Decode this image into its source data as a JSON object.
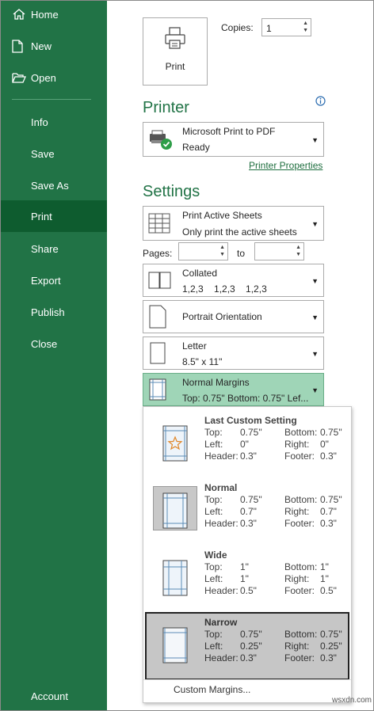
{
  "sidebar": {
    "items": [
      {
        "label": "Home",
        "icon": "home-icon"
      },
      {
        "label": "New",
        "icon": "new-document-icon"
      },
      {
        "label": "Open",
        "icon": "open-folder-icon"
      },
      {
        "label": "Info"
      },
      {
        "label": "Save"
      },
      {
        "label": "Save As"
      },
      {
        "label": "Print",
        "active": true
      },
      {
        "label": "Share"
      },
      {
        "label": "Export"
      },
      {
        "label": "Publish"
      },
      {
        "label": "Close"
      },
      {
        "label": "Account"
      }
    ],
    "bg_color": "#217346",
    "active_color": "#0e5c2f"
  },
  "print": {
    "button_label": "Print",
    "copies_label": "Copies:",
    "copies_value": "1"
  },
  "printer": {
    "title": "Printer",
    "name": "Microsoft Print to PDF",
    "status": "Ready",
    "properties_link": "Printer Properties"
  },
  "settings": {
    "title": "Settings",
    "scope": {
      "line1": "Print Active Sheets",
      "line2": "Only print the active sheets"
    },
    "pages_label": "Pages:",
    "pages_to_label": "to",
    "collation": {
      "line1": "Collated",
      "line2": "1,2,3    1,2,3    1,2,3"
    },
    "orientation": {
      "line1": "Portrait Orientation"
    },
    "paper": {
      "line1": "Letter",
      "line2": "8.5\" x 11\""
    },
    "margins": {
      "line1": "Normal Margins",
      "line2": "Top: 0.75\" Bottom: 0.75\" Lef..."
    }
  },
  "margin_options": [
    {
      "name": "Last Custom Setting",
      "top": "0.75\"",
      "bottom": "0.75\"",
      "left": "0\"",
      "right": "0\"",
      "header": "0.3\"",
      "footer": "0.3\""
    },
    {
      "name": "Normal",
      "top": "0.75\"",
      "bottom": "0.75\"",
      "left": "0.7\"",
      "right": "0.7\"",
      "header": "0.3\"",
      "footer": "0.3\""
    },
    {
      "name": "Wide",
      "top": "1\"",
      "bottom": "1\"",
      "left": "1\"",
      "right": "1\"",
      "header": "0.5\"",
      "footer": "0.5\""
    },
    {
      "name": "Narrow",
      "top": "0.75\"",
      "bottom": "0.75\"",
      "left": "0.25\"",
      "right": "0.25\"",
      "header": "0.3\"",
      "footer": "0.3\"",
      "selected": true
    }
  ],
  "margin_labels": {
    "top": "Top:",
    "bottom": "Bottom:",
    "left": "Left:",
    "right": "Right:",
    "header": "Header:",
    "footer": "Footer:"
  },
  "custom_margins_label": "Custom Margins...",
  "watermark": "wsxdn.com"
}
